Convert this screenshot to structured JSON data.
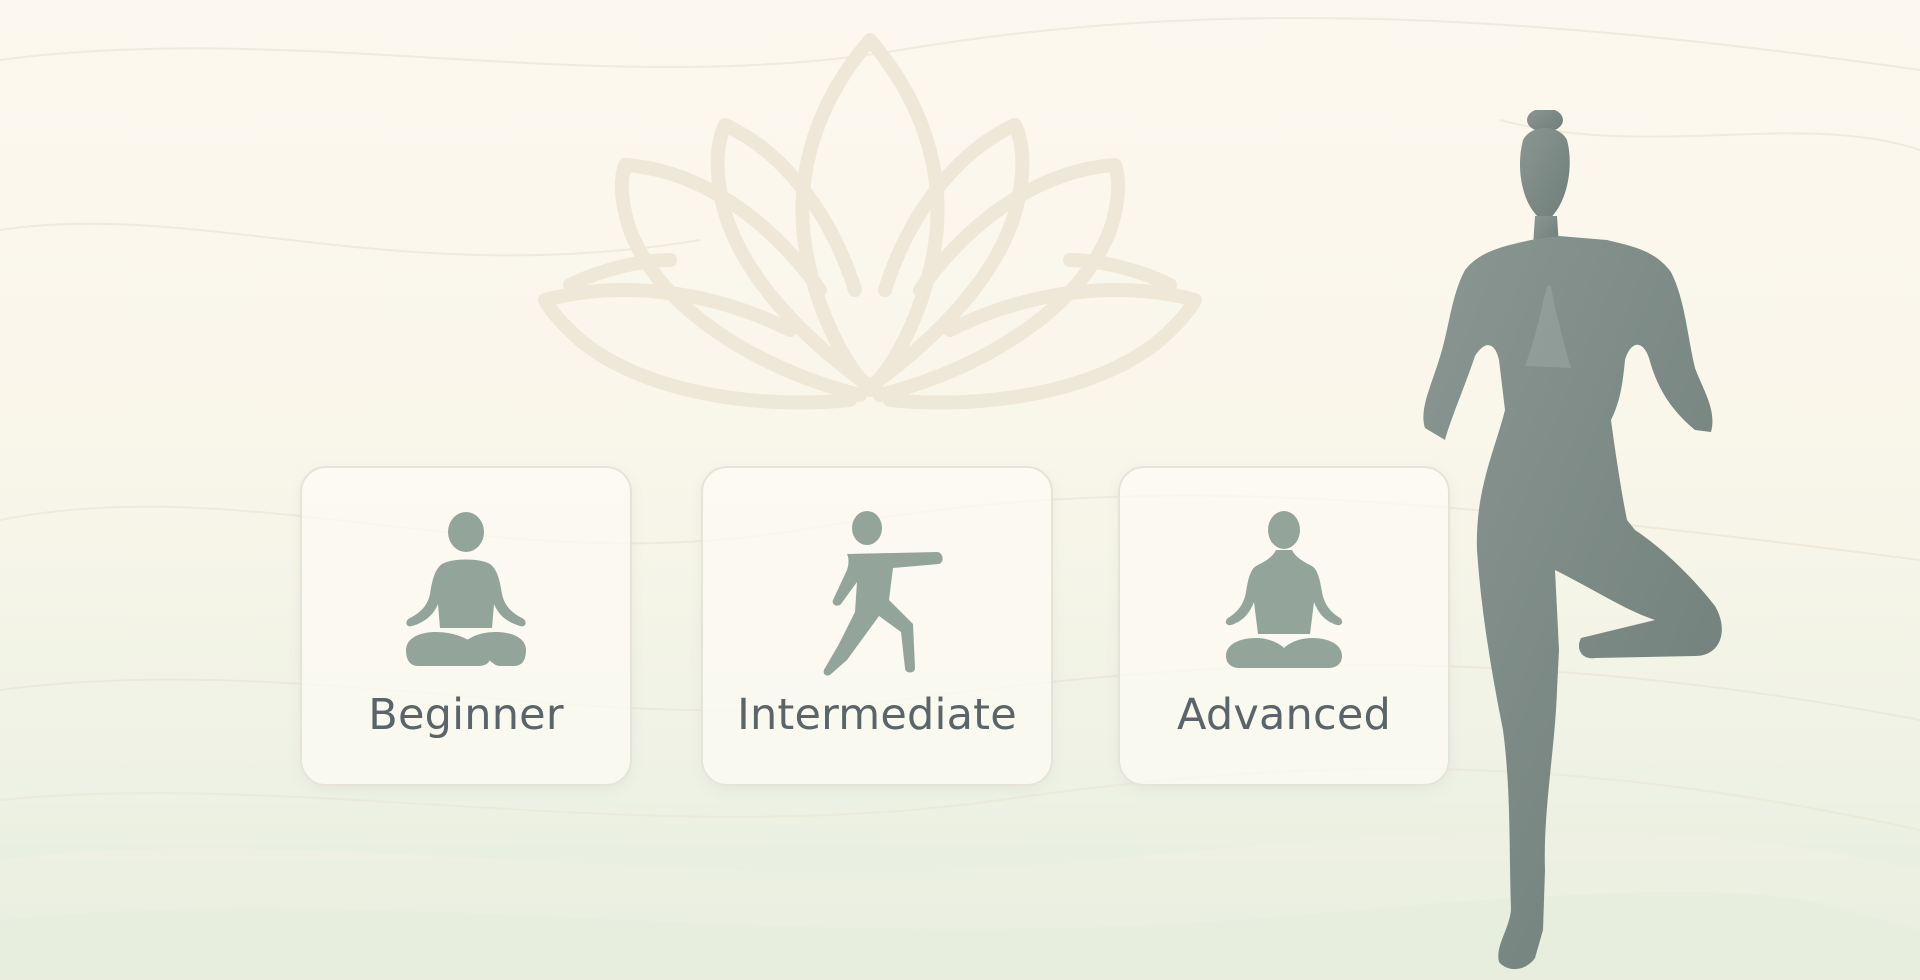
{
  "levels": [
    {
      "id": "beginner",
      "label": "Beginner",
      "icon": "lotus-pose-icon"
    },
    {
      "id": "intermediate",
      "label": "Intermediate",
      "icon": "warrior-pose-icon"
    },
    {
      "id": "advanced",
      "label": "Advanced",
      "icon": "seated-meditation-icon"
    }
  ],
  "colors": {
    "icon": "#93a59a",
    "text": "#5a6469",
    "figure": "#7d8b86",
    "card_border": "#e6e4d8"
  }
}
